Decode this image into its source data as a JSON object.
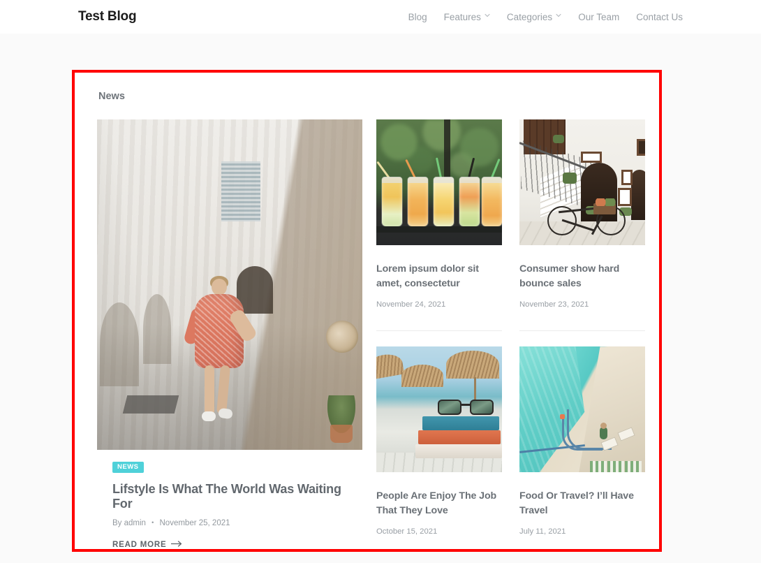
{
  "header": {
    "brand": "Test Blog",
    "nav": [
      {
        "label": "Blog",
        "has_dropdown": false
      },
      {
        "label": "Features",
        "has_dropdown": true
      },
      {
        "label": "Categories",
        "has_dropdown": true
      },
      {
        "label": "Our Team",
        "has_dropdown": false
      },
      {
        "label": "Contact Us",
        "has_dropdown": false
      }
    ]
  },
  "highlight": {
    "border_color": "#ff0000"
  },
  "section": {
    "title": "News"
  },
  "featured": {
    "image_alt": "woman-walking-white-alley-image",
    "badge": "NEWS",
    "badge_color": "#4fd1d9",
    "title": "Lifstyle Is What The World Was Waiting For",
    "author": "By admin",
    "separator": "•",
    "date": "November 25, 2021",
    "read_more": "READ MORE",
    "read_more_arrow": "⟶"
  },
  "side_posts": [
    {
      "image_alt": "fruit-infused-mason-jars-image",
      "title": "Lorem ipsum dolor sit amet, consectetur",
      "date": "November 24, 2021"
    },
    {
      "image_alt": "white-building-bicycle-image",
      "title": "Consumer show hard bounce sales",
      "date": "November 23, 2021"
    },
    {
      "image_alt": "beach-books-sunglasses-image",
      "title": "People Are Enjoy The Job That They Love",
      "date": "October 15, 2021"
    },
    {
      "image_alt": "aerial-swimming-pool-image",
      "title": "Food Or Travel? I’ll Have Travel",
      "date": "July 11, 2021"
    }
  ]
}
